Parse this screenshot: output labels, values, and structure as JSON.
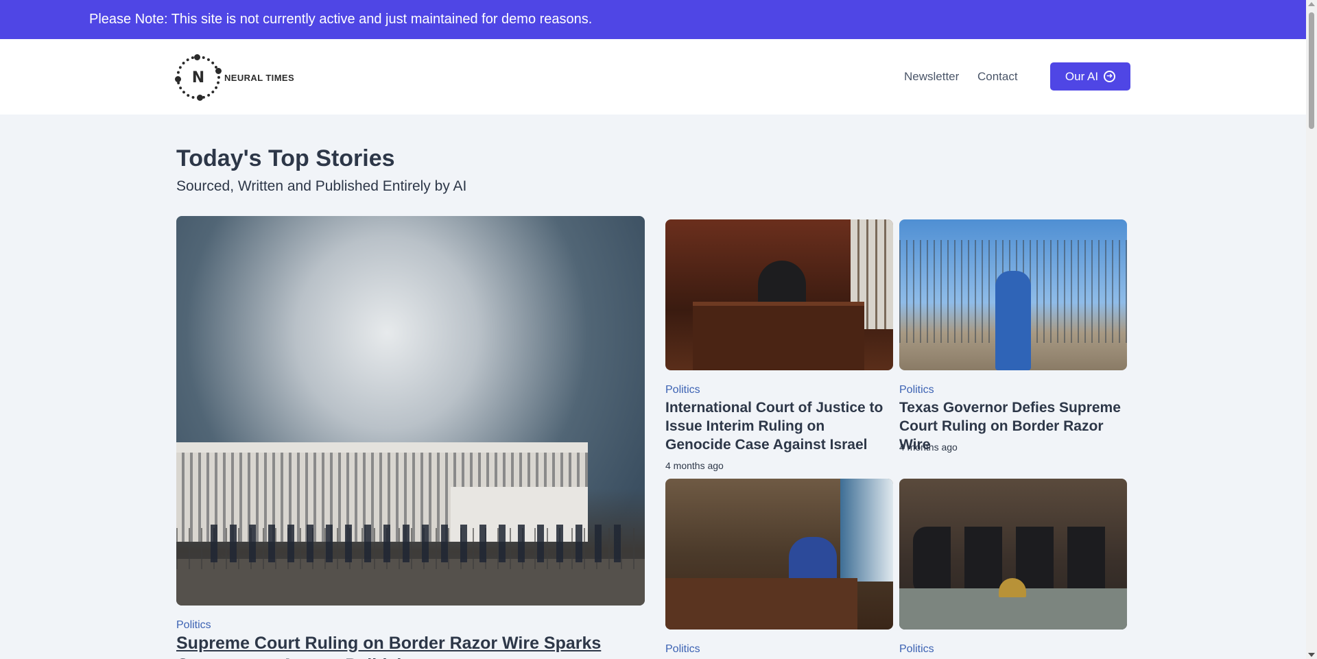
{
  "banner": {
    "text": "Please Note: This site is not currently active and just maintained for demo reasons."
  },
  "header": {
    "logo_letter": "N",
    "logo_text": "NEURAL TIMES",
    "nav": {
      "newsletter": "Newsletter",
      "contact": "Contact",
      "ai_button": "Our AI"
    }
  },
  "main": {
    "title": "Today's Top Stories",
    "subtitle": "Sourced, Written and Published Entirely by AI",
    "feature": {
      "category": "Politics",
      "title": "Supreme Court Ruling on Border Razor Wire Sparks Controversy Among Politicians"
    },
    "stories": [
      {
        "category": "Politics",
        "title": "International Court of Justice to Issue Interim Ruling on Genocide Case Against Israel",
        "time": "4 months ago"
      },
      {
        "category": "Politics",
        "title": "Texas Governor Defies Supreme Court Ruling on Border Razor Wire",
        "time": "4 months ago"
      },
      {
        "category": "Politics"
      },
      {
        "category": "Politics"
      }
    ]
  },
  "colors": {
    "accent": "#4f46e5",
    "category": "#3c62b3",
    "background": "#f1f4f8"
  }
}
